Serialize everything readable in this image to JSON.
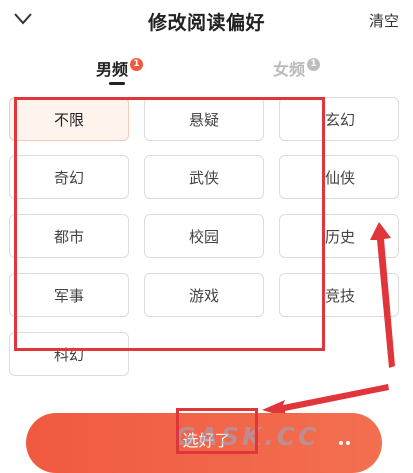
{
  "header": {
    "title": "修改阅读偏好",
    "clear_label": "清空"
  },
  "tabs": [
    {
      "label": "男频",
      "badge": "1",
      "badge_color": "#f05a40",
      "active": true
    },
    {
      "label": "女频",
      "badge": "1",
      "badge_color": "#bdbdbd",
      "active": false
    }
  ],
  "genres": [
    {
      "label": "不限",
      "selected": true
    },
    {
      "label": "悬疑",
      "selected": false
    },
    {
      "label": "玄幻",
      "selected": false
    },
    {
      "label": "奇幻",
      "selected": false
    },
    {
      "label": "武侠",
      "selected": false
    },
    {
      "label": "仙侠",
      "selected": false
    },
    {
      "label": "都市",
      "selected": false
    },
    {
      "label": "校园",
      "selected": false
    },
    {
      "label": "历史",
      "selected": false
    },
    {
      "label": "军事",
      "selected": false
    },
    {
      "label": "游戏",
      "selected": false
    },
    {
      "label": "竞技",
      "selected": false
    },
    {
      "label": "科幻",
      "selected": false
    }
  ],
  "footer": {
    "submit_label": "选好了"
  },
  "watermark": "GASK.CC",
  "colors": {
    "accent": "#f05a40",
    "annotation": "#e0353a"
  }
}
